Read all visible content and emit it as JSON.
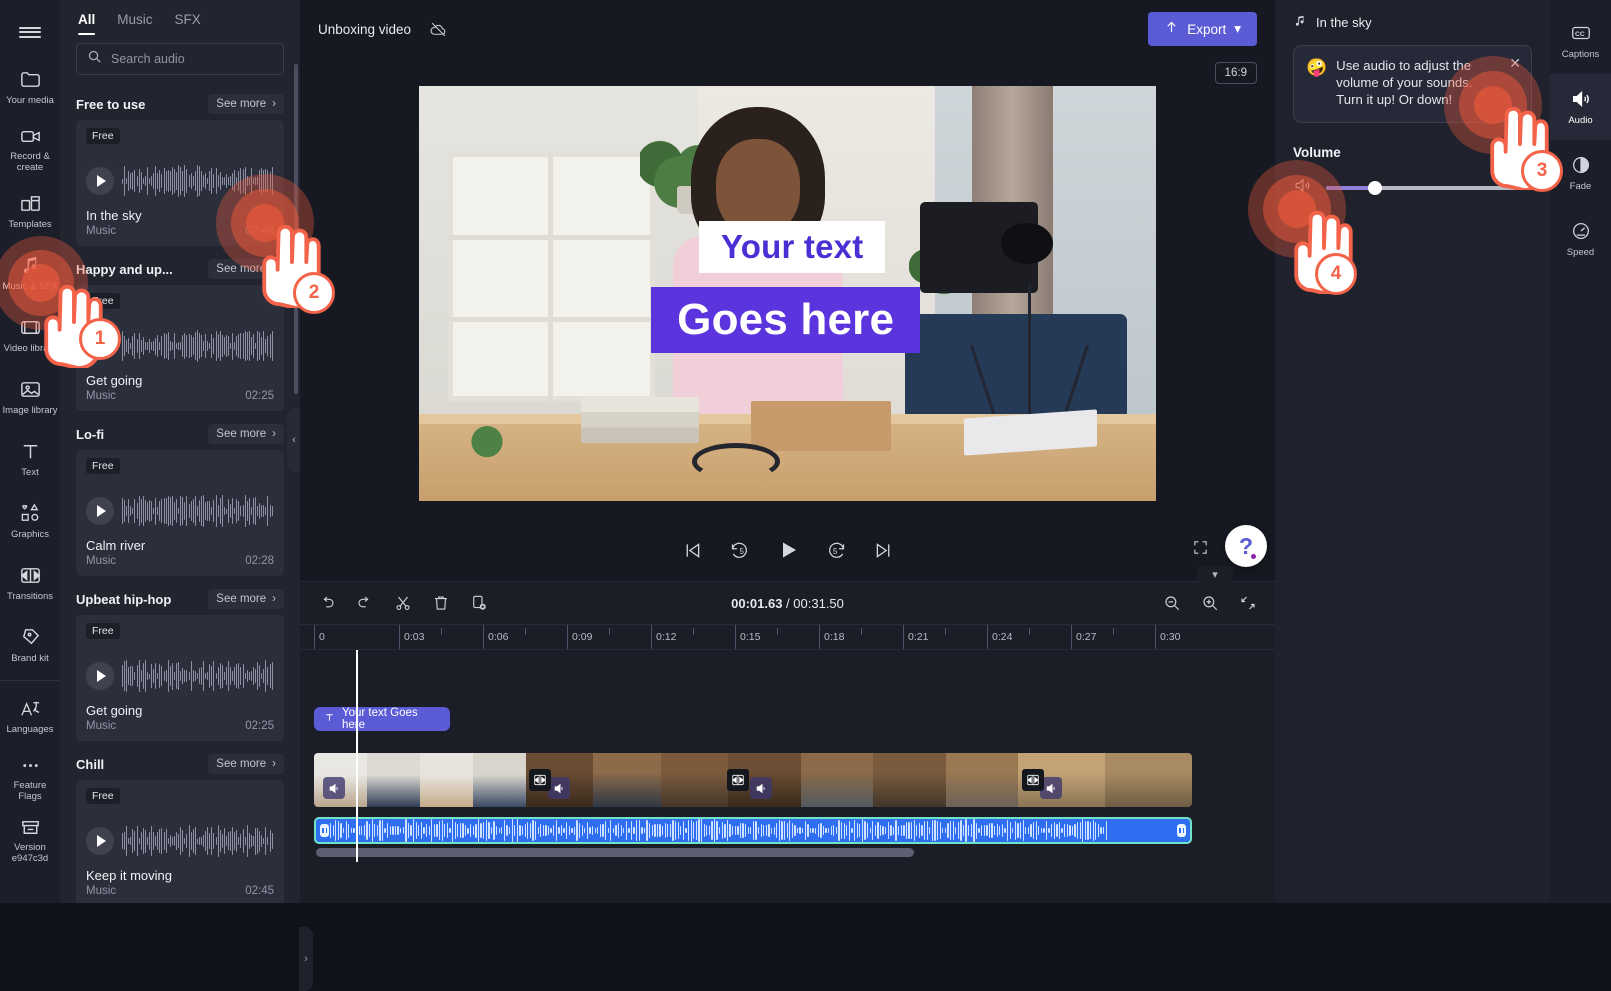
{
  "left_rail": {
    "menu_icon": "hamburger-icon",
    "items": [
      {
        "label": "Your media",
        "icon": "folder-icon",
        "selected": false
      },
      {
        "label": "Record & create",
        "icon": "video-camera-icon",
        "selected": false
      },
      {
        "label": "Templates",
        "icon": "templates-icon",
        "selected": false
      },
      {
        "label": "Music & SFX",
        "icon": "music-note-icon",
        "selected": true
      },
      {
        "label": "Video library",
        "icon": "video-library-icon",
        "selected": false
      },
      {
        "label": "Image library",
        "icon": "image-icon",
        "selected": false
      },
      {
        "label": "Text",
        "icon": "text-icon",
        "selected": false
      },
      {
        "label": "Graphics",
        "icon": "shapes-icon",
        "selected": false
      },
      {
        "label": "Transitions",
        "icon": "transitions-icon",
        "selected": false
      },
      {
        "label": "Brand kit",
        "icon": "brand-kit-icon",
        "selected": false
      },
      {
        "label": "Languages",
        "icon": "languages-icon",
        "selected": false
      },
      {
        "label": "Feature Flags",
        "icon": "ellipsis-icon",
        "selected": false
      },
      {
        "label": "Version e947c3d",
        "icon": "box-icon",
        "selected": false
      }
    ]
  },
  "library": {
    "tabs": [
      {
        "label": "All",
        "active": true
      },
      {
        "label": "Music",
        "active": false
      },
      {
        "label": "SFX",
        "active": false
      }
    ],
    "search": {
      "value": "",
      "placeholder": "Search audio",
      "icon": "search-icon"
    },
    "see_more_label": "See more",
    "free_badge": "Free",
    "categories": [
      {
        "title": "Free to use",
        "track": {
          "name": "In the sky",
          "kind": "Music",
          "duration": "02:48"
        }
      },
      {
        "title": "Happy and up...",
        "track": {
          "name": "Get going",
          "kind": "Music",
          "duration": "02:25"
        }
      },
      {
        "title": "Lo-fi",
        "track": {
          "name": "Calm river",
          "kind": "Music",
          "duration": "02:28"
        }
      },
      {
        "title": "Upbeat hip-hop",
        "track": {
          "name": "Get going",
          "kind": "Music",
          "duration": "02:25"
        }
      },
      {
        "title": "Chill",
        "track": {
          "name": "Keep it moving",
          "kind": "Music",
          "duration": "02:45"
        }
      }
    ]
  },
  "topbar": {
    "project_title": "Unboxing video",
    "autosave_icon": "cloud-off-icon",
    "export_label": "Export",
    "export_icon": "upload-icon",
    "export_chevron": "chevron-down-icon"
  },
  "stage": {
    "aspect_ratio": "16:9",
    "overlay_text_line1": "Your text",
    "overlay_text_line2": "Goes here"
  },
  "playback": {
    "skip_start_icon": "skip-to-start-icon",
    "back5_icon": "rewind-5-icon",
    "play_icon": "play-icon",
    "fwd5_icon": "forward-5-icon",
    "skip_end_icon": "skip-to-end-icon",
    "fullscreen_icon": "fullscreen-icon",
    "help_label": "?"
  },
  "timeline": {
    "collapse_icon": "chevron-down-icon",
    "tools": [
      {
        "name": "undo",
        "icon": "undo-icon"
      },
      {
        "name": "redo",
        "icon": "redo-icon"
      },
      {
        "name": "split",
        "icon": "scissors-icon"
      },
      {
        "name": "delete",
        "icon": "trash-icon"
      },
      {
        "name": "duplicate",
        "icon": "duplicate-icon"
      }
    ],
    "current_time": "00:01.63",
    "separator": " / ",
    "total_time": "00:31.50",
    "zoom_out_icon": "zoom-out-icon",
    "zoom_in_icon": "zoom-in-icon",
    "fit_icon": "fit-to-screen-icon",
    "ruler_ticks": [
      "0",
      "0:03",
      "0:06",
      "0:09",
      "0:12",
      "0:15",
      "0:18",
      "0:21",
      "0:24",
      "0:27",
      "0:30"
    ],
    "text_clip": {
      "label": "Your text Goes here",
      "icon": "text-icon"
    },
    "video_clip_name": "video-clip",
    "audio_clip_name": "audio-clip"
  },
  "properties": {
    "title": "In the sky",
    "title_icon": "music-note-icon",
    "coach": {
      "emoji": "🤪",
      "text": "Use audio to adjust the volume of your sounds. Turn it up! Or down!",
      "close_icon": "close-icon"
    },
    "volume": {
      "label": "Volume",
      "value_text": "24%",
      "value_pct": 24,
      "icon": "speaker-icon"
    }
  },
  "right_rail": {
    "items": [
      {
        "label": "Captions",
        "icon": "closed-captions-icon",
        "selected": false
      },
      {
        "label": "Audio",
        "icon": "speaker-icon",
        "selected": true
      },
      {
        "label": "Fade",
        "icon": "fade-icon",
        "selected": false
      },
      {
        "label": "Speed",
        "icon": "speedometer-icon",
        "selected": false
      }
    ]
  },
  "annotations": {
    "accent": "#f2634a",
    "steps": [
      {
        "number": "1",
        "target": "sidebar-item-music-sfx"
      },
      {
        "number": "2",
        "target": "library-track-in-the-sky"
      },
      {
        "number": "3",
        "target": "right-rail-item-audio"
      },
      {
        "number": "4",
        "target": "volume-slider"
      }
    ]
  }
}
